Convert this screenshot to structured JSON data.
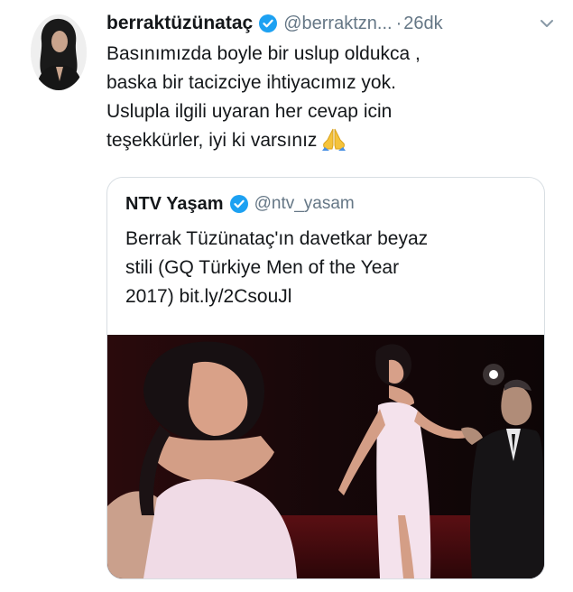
{
  "tweet": {
    "display_name": "berraktüzünataç",
    "handle": "@berraktzn...",
    "separator": "·",
    "time": "26dk",
    "text_lines": [
      "Basınımızda boyle bir uslup oldukca ,",
      "baska bir tacizciye ihtiyacımız yok.",
      "Uslupla ilgili uyaran her cevap icin",
      "teşekkürler, iyi ki varsınız"
    ],
    "emoji_icon": "folded-hands-icon"
  },
  "quoted_tweet": {
    "display_name": "NTV Yaşam",
    "handle": "@ntv_yasam",
    "text_lines": [
      "Berrak Tüzünataç'ın davetkar beyaz",
      "stili (GQ Türkiye Men of the Year",
      "2017) bit.ly/2CsouJl"
    ]
  },
  "colors": {
    "text": "#14171a",
    "secondary": "#657786",
    "verified": "#1da1f2",
    "border": "#d8dee3"
  }
}
